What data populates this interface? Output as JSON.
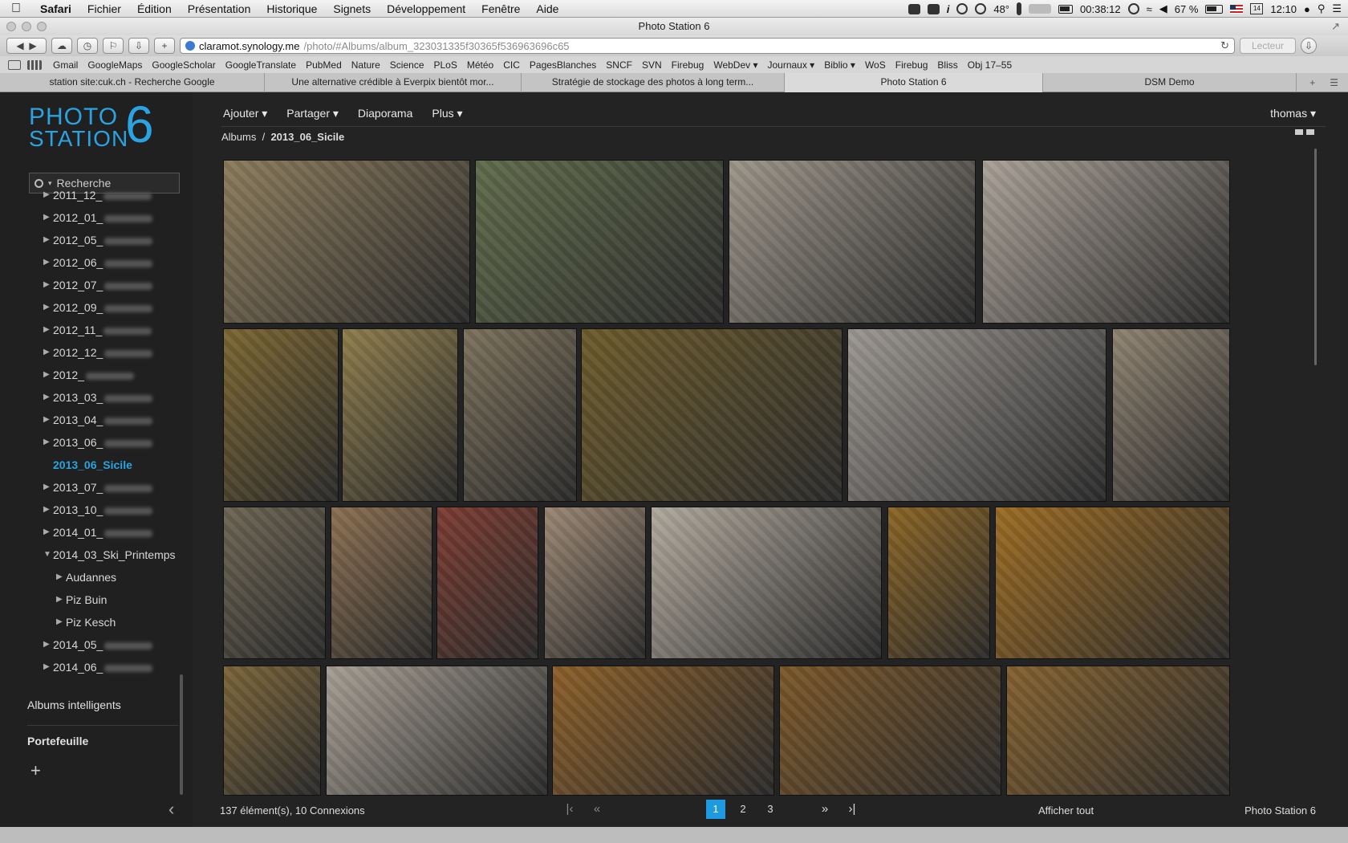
{
  "menubar": {
    "app": "Safari",
    "items": [
      "Fichier",
      "Édition",
      "Présentation",
      "Historique",
      "Signets",
      "Développement",
      "Fenêtre",
      "Aide"
    ],
    "temperature": "48°",
    "timer": "00:38:12",
    "battery": "67 %",
    "clock": "12:10",
    "calendar_day": "14"
  },
  "window": {
    "title": "Photo Station 6"
  },
  "toolbar": {
    "url_host": "claramot.synology.me",
    "url_path": "/photo/#Albums/album_323031335f30365f536963696c65",
    "reader_label": "Lecteur"
  },
  "bookmarks": [
    "Gmail",
    "GoogleMaps",
    "GoogleScholar",
    "GoogleTranslate",
    "PubMed",
    "Nature",
    "Science",
    "PLoS",
    "Météo",
    "CIC",
    "PagesBlanches",
    "SNCF",
    "SVN",
    "Firebug",
    "WebDev ▾",
    "Journaux ▾",
    "Biblio ▾",
    "WoS",
    "Firebug",
    "Bliss",
    "Obj 17–55"
  ],
  "tabs": [
    {
      "label": "station site:cuk.ch - Recherche Google"
    },
    {
      "label": "Une alternative crédible à Everpix bientôt mor..."
    },
    {
      "label": "Stratégie de stockage des photos à long term..."
    },
    {
      "label": "Photo Station 6"
    },
    {
      "label": "DSM Demo"
    }
  ],
  "logo": {
    "line1": "PHOTO",
    "line2": "STATION",
    "digit": "6"
  },
  "search": {
    "placeholder": "Recherche"
  },
  "albums": [
    {
      "label": "2011_12_",
      "blurred": true
    },
    {
      "label": "2012_01_",
      "blurred": true
    },
    {
      "label": "2012_05_",
      "blurred": true
    },
    {
      "label": "2012_06_",
      "blurred": true
    },
    {
      "label": "2012_07_",
      "blurred": true
    },
    {
      "label": "2012_09_",
      "blurred": true
    },
    {
      "label": "2012_11_",
      "blurred": true
    },
    {
      "label": "2012_12_",
      "blurred": true
    },
    {
      "label": "2012_",
      "blurred": true
    },
    {
      "label": "2013_03_",
      "blurred": true
    },
    {
      "label": "2013_04_",
      "blurred": true
    },
    {
      "label": "2013_06_",
      "blurred": true
    },
    {
      "label": "2013_06_Sicile",
      "active": true
    },
    {
      "label": "2013_07_",
      "blurred": true
    },
    {
      "label": "2013_10_",
      "blurred": true
    },
    {
      "label": "2014_01_",
      "blurred": true
    },
    {
      "label": "2014_03_Ski_Printemps",
      "expanded": true
    },
    {
      "label": "Audannes",
      "sub": true
    },
    {
      "label": "Piz Buin",
      "sub": true
    },
    {
      "label": "Piz Kesch",
      "sub": true
    },
    {
      "label": "2014_05_",
      "blurred": true
    },
    {
      "label": "2014_06_",
      "blurred": true
    }
  ],
  "sidebar": {
    "smart_albums": "Albums intelligents",
    "portfolio": "Portefeuille"
  },
  "main_menu": [
    "Ajouter ▾",
    "Partager ▾",
    "Diaporama",
    "Plus ▾"
  ],
  "user": "thomas ▾",
  "breadcrumb": {
    "root": "Albums",
    "separator": "/",
    "current": "2013_06_Sicile"
  },
  "photos": [
    {
      "color": "#8a7a5a"
    },
    {
      "color": "#5f6a4a"
    },
    {
      "color": "#9b9488"
    },
    {
      "color": "#a9a096"
    },
    {
      "color": "#7a6530"
    },
    {
      "color": "#8c7b4a"
    },
    {
      "color": "#7b705a"
    },
    {
      "color": "#6b5a2a"
    },
    {
      "color": "#9a9590"
    },
    {
      "color": "#8e8270"
    },
    {
      "color": "#6c6452"
    },
    {
      "color": "#8a6e50"
    },
    {
      "color": "#7b3b30"
    },
    {
      "color": "#9a8672"
    },
    {
      "color": "#b0a89c"
    },
    {
      "color": "#8a6424"
    },
    {
      "color": "#9a6a22"
    },
    {
      "color": "#7a6438"
    },
    {
      "color": "#a59d92"
    },
    {
      "color": "#8a5e28"
    },
    {
      "color": "#7a5628"
    },
    {
      "color": "#83602e"
    }
  ],
  "footer": {
    "count": "137 élément(s), 10 Connexions",
    "pages": [
      "1",
      "2",
      "3"
    ],
    "current_page": "1",
    "show_all": "Afficher tout",
    "brand": "Photo Station 6"
  }
}
